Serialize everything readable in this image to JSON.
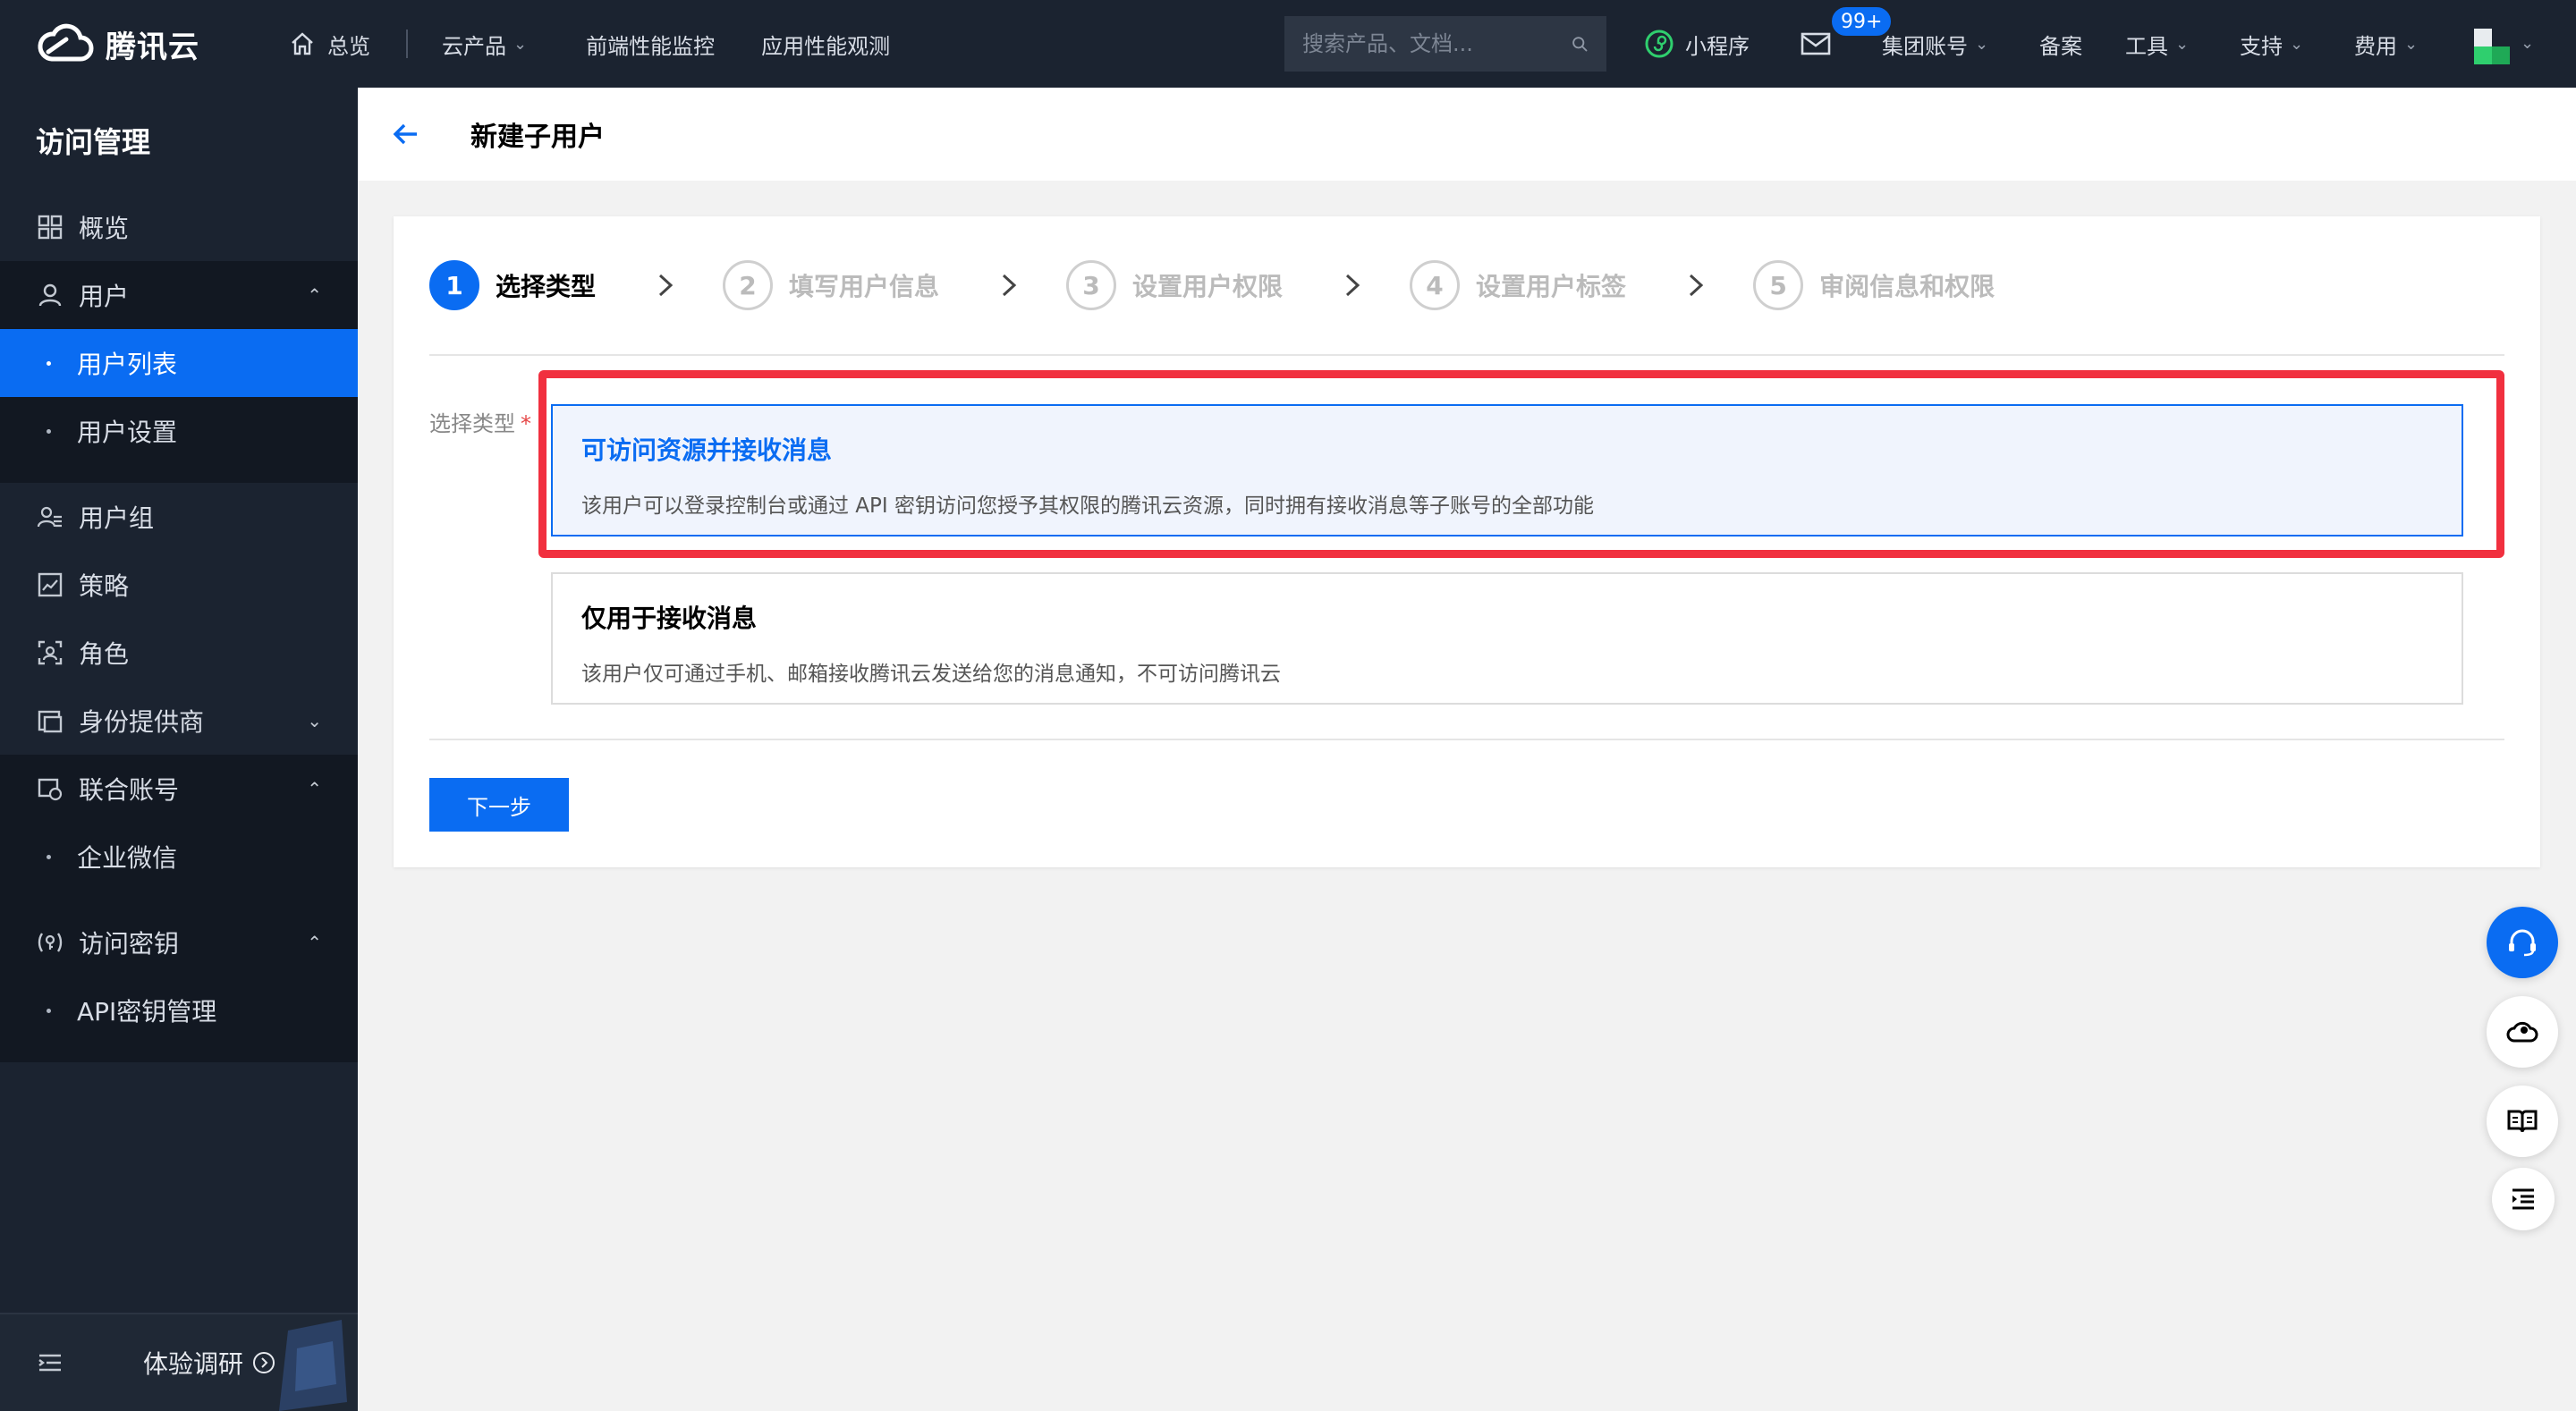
{
  "topbar": {
    "logo_text": "腾讯云",
    "home_label": "总览",
    "cloud_products": "云产品",
    "nav_frontend": "前端性能监控",
    "nav_apm": "应用性能观测",
    "search_placeholder": "搜索产品、文档...",
    "mini_program": "小程序",
    "mail_badge": "99+",
    "group_account": "集团账号",
    "icp": "备案",
    "tools": "工具",
    "support": "支持",
    "billing": "费用"
  },
  "sidebar": {
    "title": "访问管理",
    "overview": "概览",
    "users": "用户",
    "user_list": "用户列表",
    "user_settings": "用户设置",
    "user_groups": "用户组",
    "policies": "策略",
    "roles": "角色",
    "identity_providers": "身份提供商",
    "federated_accounts": "联合账号",
    "wecom": "企业微信",
    "access_keys": "访问密钥",
    "api_key_mgmt": "API密钥管理",
    "survey": "体验调研"
  },
  "header": {
    "title": "新建子用户"
  },
  "steps": [
    {
      "num": "1",
      "label": "选择类型"
    },
    {
      "num": "2",
      "label": "填写用户信息"
    },
    {
      "num": "3",
      "label": "设置用户权限"
    },
    {
      "num": "4",
      "label": "设置用户标签"
    },
    {
      "num": "5",
      "label": "审阅信息和权限"
    }
  ],
  "form": {
    "type_label": "选择类型",
    "required_mark": "*",
    "options": [
      {
        "title": "可访问资源并接收消息",
        "desc": "该用户可以登录控制台或通过 API 密钥访问您授予其权限的腾讯云资源，同时拥有接收消息等子账号的全部功能",
        "selected": true
      },
      {
        "title": "仅用于接收消息",
        "desc": "该用户仅可通过手机、邮箱接收腾讯云发送给您的消息通知，不可访问腾讯云",
        "selected": false
      }
    ],
    "next_label": "下一步"
  },
  "colors": {
    "primary": "#0a6cf2",
    "topbar": "#1b2330",
    "highlight": "#f1303f"
  },
  "icons": {
    "fab": [
      "headset-icon",
      "cloud-icon",
      "book-icon",
      "list-indent-icon"
    ]
  }
}
